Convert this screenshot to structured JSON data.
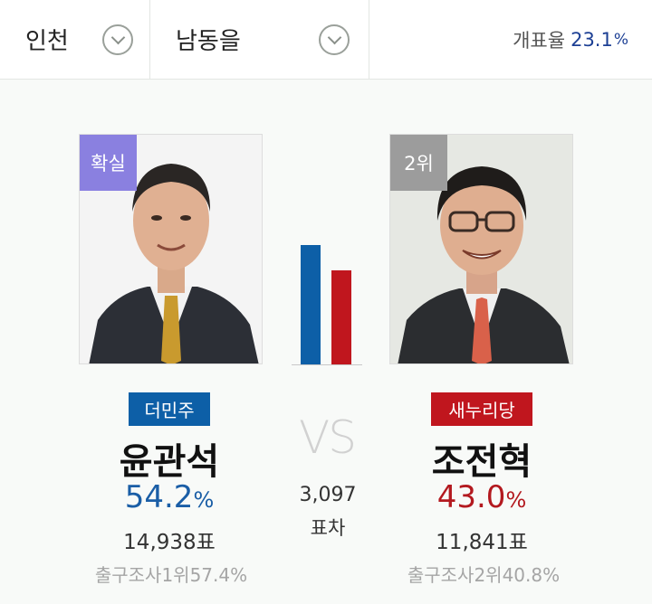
{
  "header": {
    "region": "인천",
    "district": "남동을",
    "turnout_label": "개표율",
    "turnout_value": "23.1",
    "turnout_unit": "%"
  },
  "colors": {
    "party_left": "#0d5fa7",
    "party_right": "#c0161e",
    "win_badge": "#8a80e0",
    "rank_badge": "#9c9c9c"
  },
  "left": {
    "badge": "확실",
    "party": "더민주",
    "name": "윤관석",
    "pct": "54.2",
    "pct_unit": "%",
    "votes": "14,938표",
    "exit_poll": "출구조사1위57.4%"
  },
  "right": {
    "badge": "2위",
    "party": "새누리당",
    "name": "조전혁",
    "pct": "43.0",
    "pct_unit": "%",
    "votes": "11,841표",
    "exit_poll": "출구조사2위40.8%"
  },
  "middle": {
    "vs": "VS",
    "difference": "3,097",
    "difference_label": "표차"
  },
  "bar_share": {
    "left": 54.2,
    "right": 43.0
  }
}
